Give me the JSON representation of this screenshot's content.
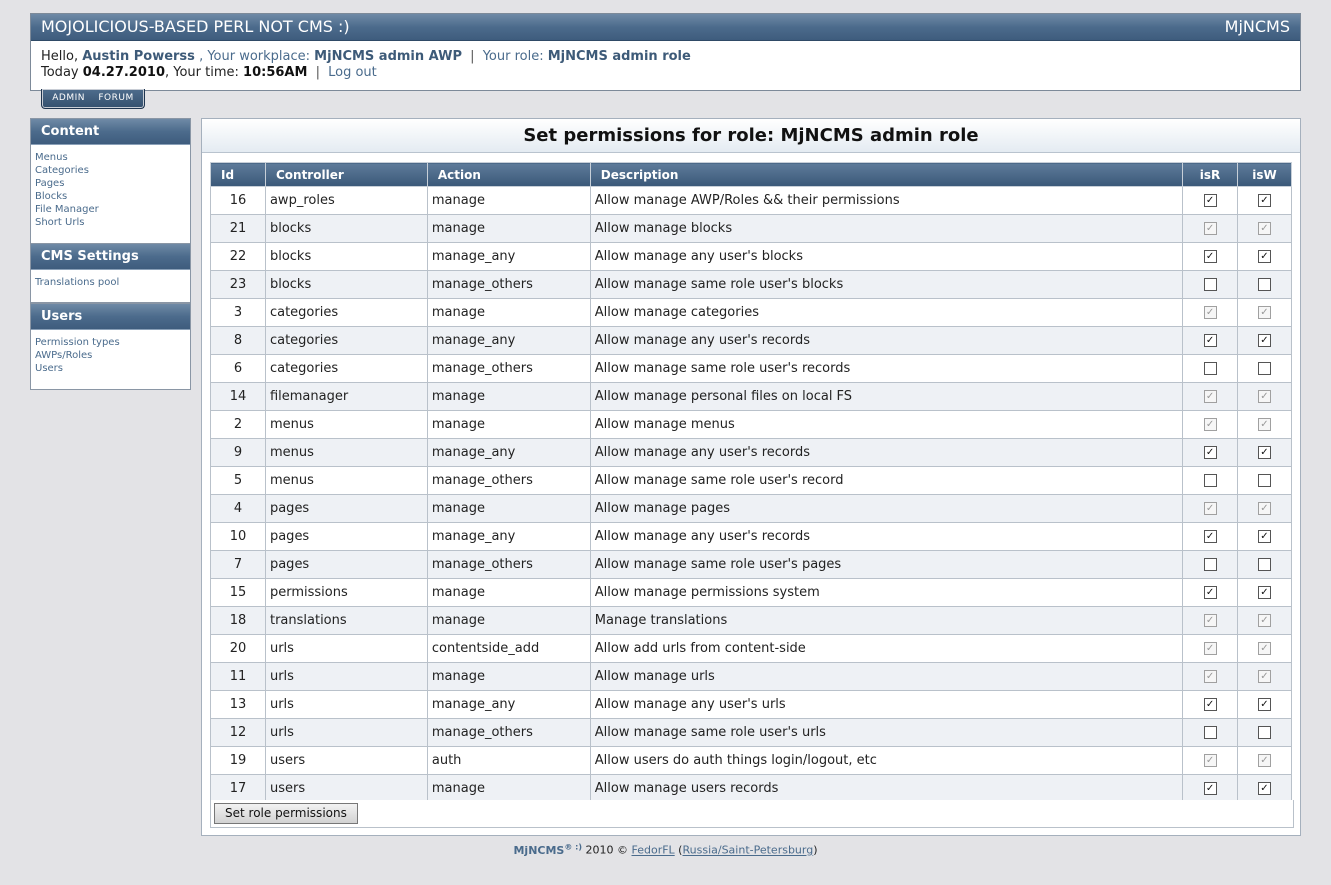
{
  "header": {
    "title": "MOJOLICIOUS-BASED PERL NOT CMS :)",
    "brand": "MjNCMS",
    "hello": "Hello,",
    "user_name": "Austin Powerss",
    "workplace_label": ", Your workplace:",
    "workplace": "MjNCMS admin AWP",
    "role_label": "Your role:",
    "role": "MjNCMS admin role",
    "today_label": "Today",
    "date": "04.27.2010",
    "time_label": ", Your time:",
    "time": "10:56AM",
    "logout": "Log out"
  },
  "tabs": [
    "ADMIN",
    "FORUM"
  ],
  "sidebar": {
    "content": {
      "title": "Content",
      "items": [
        "Menus",
        "Categories",
        "Pages",
        "Blocks",
        "File Manager",
        "Short Urls"
      ]
    },
    "settings": {
      "title": "CMS Settings",
      "items": [
        "Translations pool"
      ]
    },
    "users": {
      "title": "Users",
      "items": [
        "Permission types",
        "AWPs/Roles",
        "Users"
      ]
    }
  },
  "main": {
    "title": "Set permissions for role: MjNCMS admin role",
    "columns": [
      "Id",
      "Controller",
      "Action",
      "Description",
      "isR",
      "isW"
    ],
    "rows": [
      {
        "id": "16",
        "controller": "awp_roles",
        "action": "manage",
        "description": "Allow manage AWP/Roles && their permissions",
        "isr": "checked",
        "isw": "checked"
      },
      {
        "id": "21",
        "controller": "blocks",
        "action": "manage",
        "description": "Allow manage blocks",
        "isr": "disabled",
        "isw": "disabled"
      },
      {
        "id": "22",
        "controller": "blocks",
        "action": "manage_any",
        "description": "Allow manage any user's blocks",
        "isr": "checked",
        "isw": "checked"
      },
      {
        "id": "23",
        "controller": "blocks",
        "action": "manage_others",
        "description": "Allow manage same role user's blocks",
        "isr": "unchecked",
        "isw": "unchecked"
      },
      {
        "id": "3",
        "controller": "categories",
        "action": "manage",
        "description": "Allow manage categories",
        "isr": "disabled",
        "isw": "disabled"
      },
      {
        "id": "8",
        "controller": "categories",
        "action": "manage_any",
        "description": "Allow manage any user's records",
        "isr": "checked",
        "isw": "checked"
      },
      {
        "id": "6",
        "controller": "categories",
        "action": "manage_others",
        "description": "Allow manage same role user's records",
        "isr": "unchecked",
        "isw": "unchecked"
      },
      {
        "id": "14",
        "controller": "filemanager",
        "action": "manage",
        "description": "Allow manage personal files on local FS",
        "isr": "disabled",
        "isw": "disabled"
      },
      {
        "id": "2",
        "controller": "menus",
        "action": "manage",
        "description": "Allow manage menus",
        "isr": "disabled",
        "isw": "disabled"
      },
      {
        "id": "9",
        "controller": "menus",
        "action": "manage_any",
        "description": "Allow manage any user's records",
        "isr": "checked",
        "isw": "checked"
      },
      {
        "id": "5",
        "controller": "menus",
        "action": "manage_others",
        "description": "Allow manage same role user's record",
        "isr": "unchecked",
        "isw": "unchecked"
      },
      {
        "id": "4",
        "controller": "pages",
        "action": "manage",
        "description": "Allow manage pages",
        "isr": "disabled",
        "isw": "disabled"
      },
      {
        "id": "10",
        "controller": "pages",
        "action": "manage_any",
        "description": "Allow manage any user's records",
        "isr": "checked",
        "isw": "checked"
      },
      {
        "id": "7",
        "controller": "pages",
        "action": "manage_others",
        "description": "Allow manage same role user's pages",
        "isr": "unchecked",
        "isw": "unchecked"
      },
      {
        "id": "15",
        "controller": "permissions",
        "action": "manage",
        "description": "Allow manage permissions system",
        "isr": "checked",
        "isw": "checked"
      },
      {
        "id": "18",
        "controller": "translations",
        "action": "manage",
        "description": "Manage translations",
        "isr": "disabled",
        "isw": "disabled"
      },
      {
        "id": "20",
        "controller": "urls",
        "action": "contentside_add",
        "description": "Allow add urls from content-side",
        "isr": "disabled",
        "isw": "disabled"
      },
      {
        "id": "11",
        "controller": "urls",
        "action": "manage",
        "description": "Allow manage urls",
        "isr": "disabled",
        "isw": "disabled"
      },
      {
        "id": "13",
        "controller": "urls",
        "action": "manage_any",
        "description": "Allow manage any user's urls",
        "isr": "checked",
        "isw": "checked"
      },
      {
        "id": "12",
        "controller": "urls",
        "action": "manage_others",
        "description": "Allow manage same role user's urls",
        "isr": "unchecked",
        "isw": "unchecked"
      },
      {
        "id": "19",
        "controller": "users",
        "action": "auth",
        "description": "Allow users do auth things login/logout, etc",
        "isr": "disabled",
        "isw": "disabled"
      },
      {
        "id": "17",
        "controller": "users",
        "action": "manage",
        "description": "Allow manage users records",
        "isr": "checked",
        "isw": "checked"
      }
    ],
    "submit_label": "Set role permissions"
  },
  "footer": {
    "logo": "MjNCMS",
    "logo_sup": "® :)",
    "year": "2010 ©",
    "author": "FedorFL",
    "location": "Russia/Saint-Petersburg"
  }
}
